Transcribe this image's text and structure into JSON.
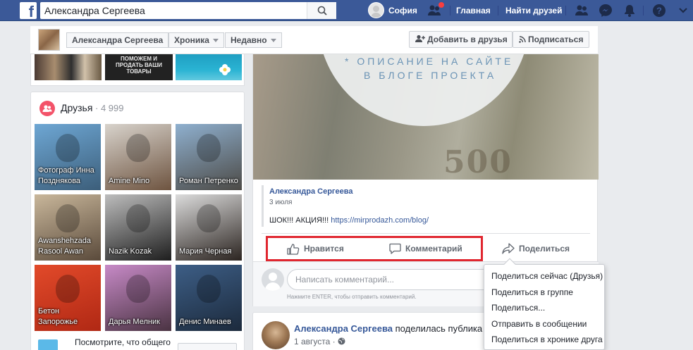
{
  "topbar": {
    "logo": "f",
    "search_value": "Александра Сергеева",
    "user_name": "София",
    "home": "Главная",
    "find_friends": "Найти друзей"
  },
  "header": {
    "profile_name": "Александра Сергеева",
    "timeline": "Хроника",
    "recent": "Недавно",
    "add_friend": "Добавить в друзья",
    "subscribe": "Подписаться"
  },
  "photo_strip": {
    "ad_text": "ПОМОЖЕМ И ПРОДАТЬ ВАШИ ТОВАРЫ"
  },
  "friends": {
    "title": "Друзья",
    "count": " · 4 999",
    "tiles": [
      {
        "name": "Фотограф Инна Позднякова",
        "c1": "#6ea7d4",
        "c2": "#3c5e7a"
      },
      {
        "name": "Amine Mino",
        "c1": "#d8d3cc",
        "c2": "#6e5440"
      },
      {
        "name": "Роман Петренко",
        "c1": "#8fb0cf",
        "c2": "#4c4a46"
      },
      {
        "name": "Awanshehzada Rasool Awan",
        "c1": "#c9b79b",
        "c2": "#5a4a3b"
      },
      {
        "name": "Nazik Kozak",
        "c1": "#bdbdbd",
        "c2": "#1e1e1e"
      },
      {
        "name": "Мария Черная",
        "c1": "#dcdcdc",
        "c2": "#2b2420"
      },
      {
        "name": "Бетон Запорожье",
        "c1": "#e24a2a",
        "c2": "#b02814"
      },
      {
        "name": "Дарья Мелник",
        "c1": "#c78ac7",
        "c2": "#4a3342"
      },
      {
        "name": "Денис Минаев",
        "c1": "#3d5e86",
        "c2": "#1c2a3c"
      }
    ],
    "see_common": "Посмотрите, что общего"
  },
  "post": {
    "banner_line1": "* ОПИСАНИЕ НА САЙТЕ",
    "banner_line2": "В БЛОГЕ ПРОЕКТА",
    "banner_number": "500",
    "shared_author": "Александра Сергеева",
    "shared_date": "3 июля",
    "shared_text": "ШОК!!! АКЦИЯ!!! ",
    "shared_link": "https://mirprodazh.com/blog/",
    "like": "Нравится",
    "comment": "Комментарий",
    "share": "Поделиться",
    "comment_placeholder": "Написать комментарий...",
    "comment_hint": "Нажмите ENTER, чтобы отправить комментарий."
  },
  "post2": {
    "author": "Александра Сергеева",
    "action": " поделилась публика",
    "date": "1 августа · "
  },
  "share_menu": [
    "Поделиться сейчас (Друзья)",
    "Поделиться в группе",
    "Поделиться...",
    "Отправить в сообщении",
    "Поделиться в хронике друга"
  ],
  "colors": {
    "brand": "#3b5998",
    "highlight": "#e0262f",
    "link": "#365899"
  }
}
